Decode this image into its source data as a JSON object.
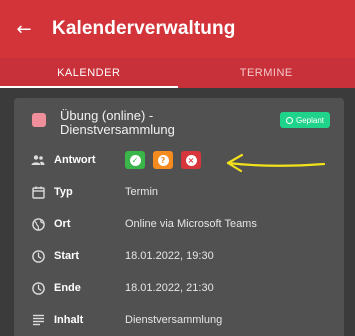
{
  "app": {
    "title": "Kalenderverwaltung",
    "back_glyph": "←"
  },
  "tabs": [
    {
      "label": "KALENDER",
      "active": true
    },
    {
      "label": "TERMINE",
      "active": false
    }
  ],
  "event": {
    "title_line1": "Übung (online) -",
    "title_line2": "Dienstversammlung",
    "color": "#ef8f99",
    "status": "Geplant",
    "status_color": "#1fd38b"
  },
  "details": {
    "answer": {
      "label": "Antwort",
      "icon": "group-icon",
      "buttons": [
        "accept",
        "maybe",
        "decline"
      ]
    },
    "type": {
      "label": "Typ",
      "value": "Termin",
      "icon": "calendar-event-icon"
    },
    "location": {
      "label": "Ort",
      "value": "Online via Microsoft Teams",
      "icon": "globe-icon"
    },
    "start": {
      "label": "Start",
      "value": "18.01.2022, 19:30",
      "icon": "clock-icon"
    },
    "end": {
      "label": "Ende",
      "value": "18.01.2022, 21:30",
      "icon": "clock-icon"
    },
    "content": {
      "label": "Inhalt",
      "value": "Dienstversammlung",
      "icon": "notes-icon"
    }
  },
  "colors": {
    "appbar": "#d2343a",
    "tabs": "#c9313a",
    "card": "#515151",
    "background": "#3b3b3b",
    "accept": "#39b54a",
    "maybe": "#f58a1f",
    "decline": "#d7363c",
    "annotation": "#f2e21b"
  }
}
